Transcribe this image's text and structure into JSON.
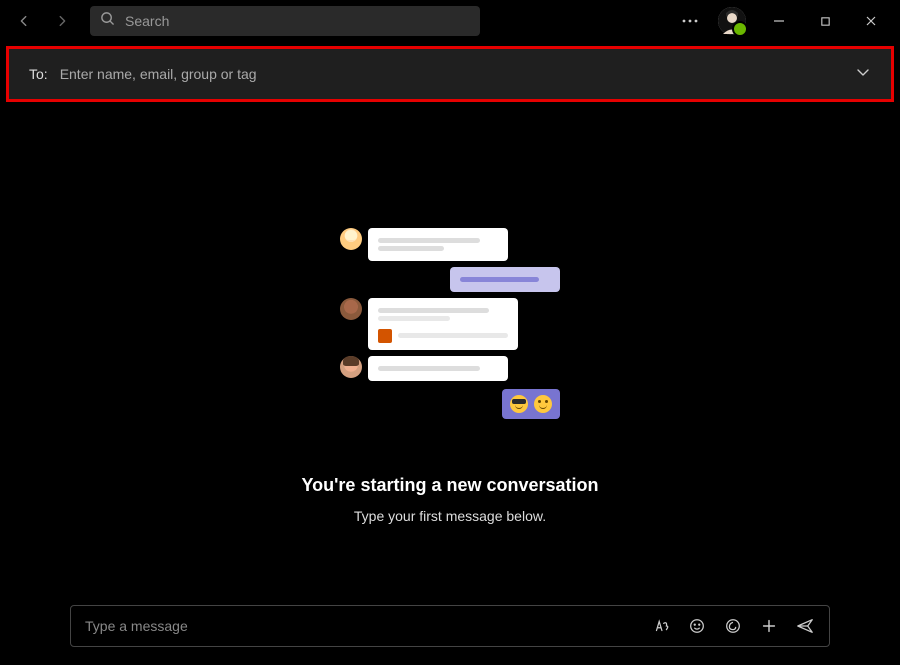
{
  "titlebar": {
    "search_placeholder": "Search"
  },
  "to_field": {
    "label": "To:",
    "placeholder": "Enter name, email, group or tag"
  },
  "empty_state": {
    "heading": "You're starting a new conversation",
    "subtext": "Type your first message below."
  },
  "compose": {
    "placeholder": "Type a message"
  }
}
